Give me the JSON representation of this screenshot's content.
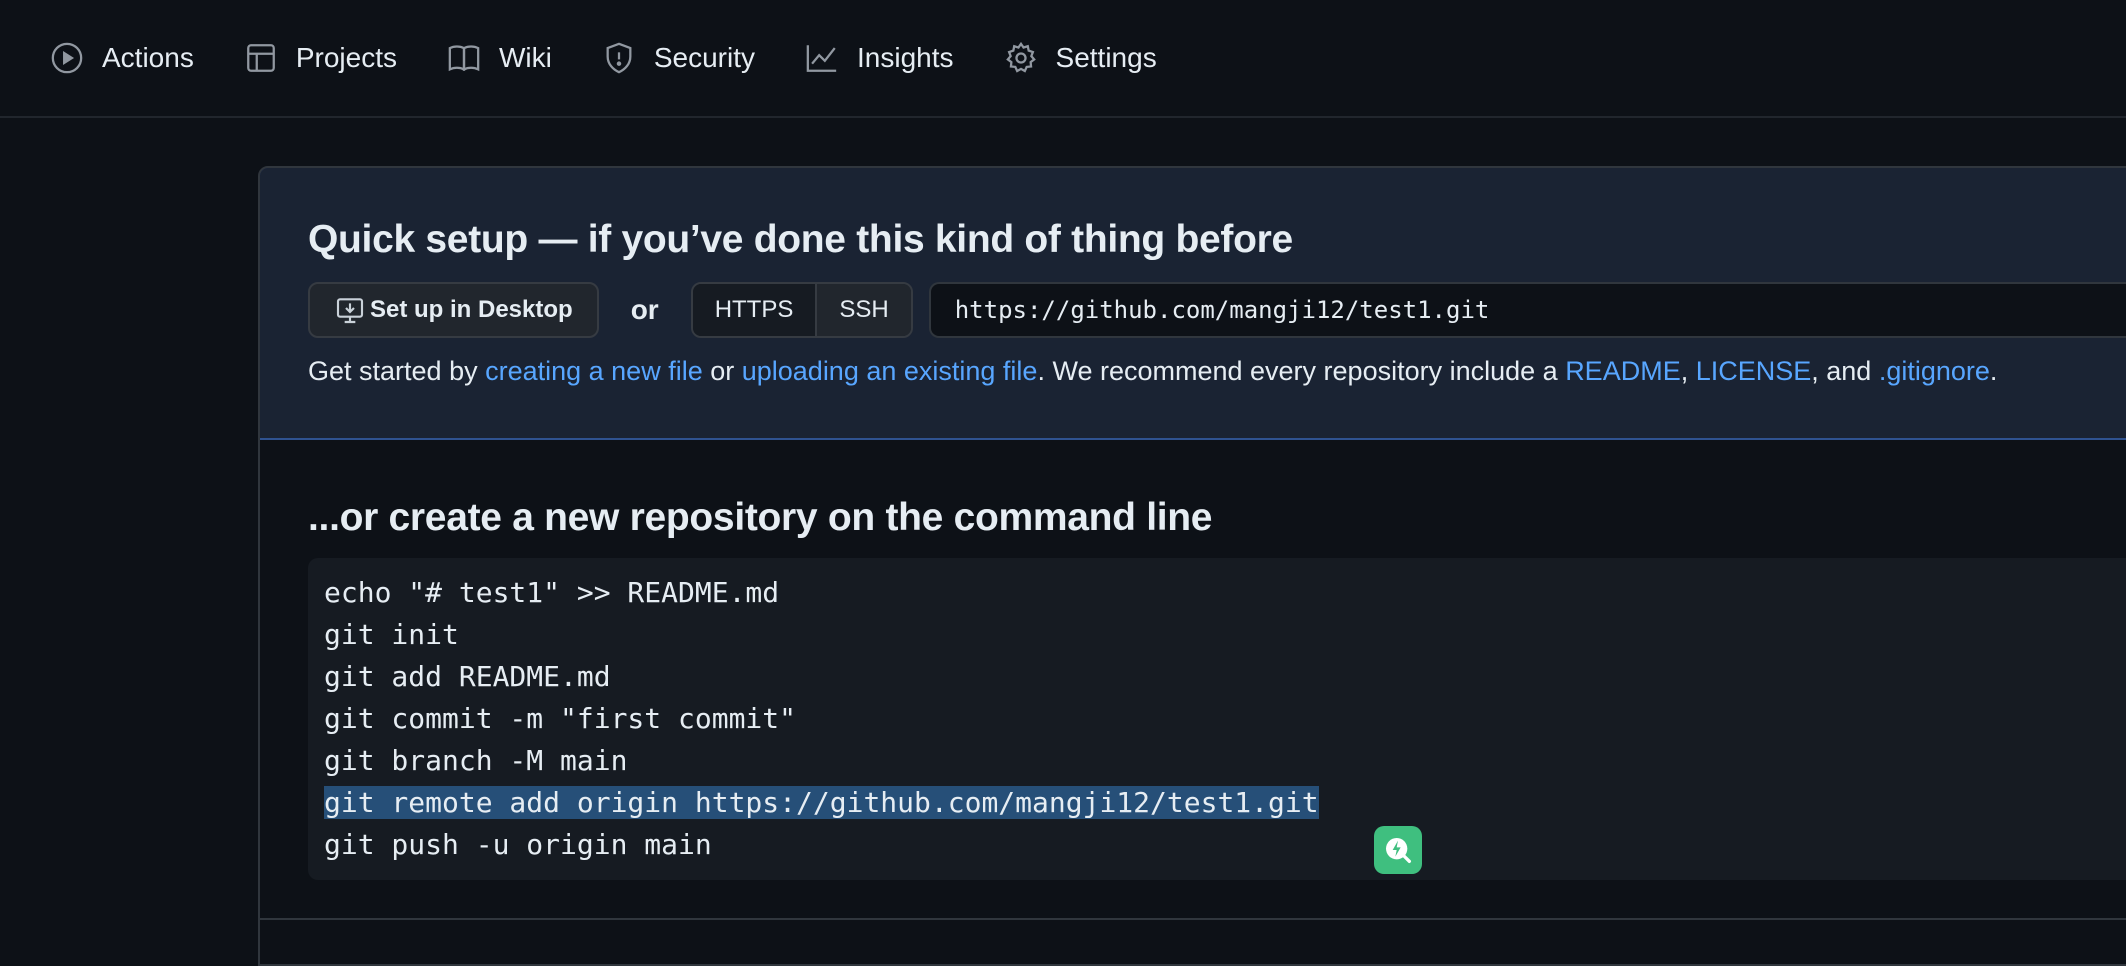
{
  "nav": {
    "items": [
      {
        "label": "Actions",
        "icon": "play-circle-icon"
      },
      {
        "label": "Projects",
        "icon": "table-icon"
      },
      {
        "label": "Wiki",
        "icon": "book-icon"
      },
      {
        "label": "Security",
        "icon": "shield-icon"
      },
      {
        "label": "Insights",
        "icon": "graph-icon"
      },
      {
        "label": "Settings",
        "icon": "gear-icon"
      }
    ]
  },
  "quick_setup": {
    "title": "Quick setup — if you’ve done this kind of thing before",
    "desktop_button": "Set up in Desktop",
    "or": "or",
    "https": "HTTPS",
    "ssh": "SSH",
    "url": "https://github.com/mangji12/test1.git",
    "hint": {
      "p1": "Get started by ",
      "link_create": "creating a new file",
      "p2": " or ",
      "link_upload": "uploading an existing file",
      "p3": ". We recommend every repository include a ",
      "link_readme": "README",
      "p4": ", ",
      "link_license": "LICENSE",
      "p5": ", and ",
      "link_gitignore": ".gitignore",
      "p6": "."
    }
  },
  "command_line": {
    "title": "...or create a new repository on the command line",
    "lines": [
      "echo \"# test1\" >> README.md",
      "git init",
      "git add README.md",
      "git commit -m \"first commit\"",
      "git branch -M main",
      "git remote add origin https://github.com/mangji12/test1.git",
      "git push -u origin main"
    ],
    "selected_line_index": 5
  },
  "colors": {
    "background": "#0d1117",
    "link": "#58a6ff",
    "quick_setup_bg": "#1a2333",
    "selection": "#264f78",
    "badge": "#3fbf7f"
  }
}
